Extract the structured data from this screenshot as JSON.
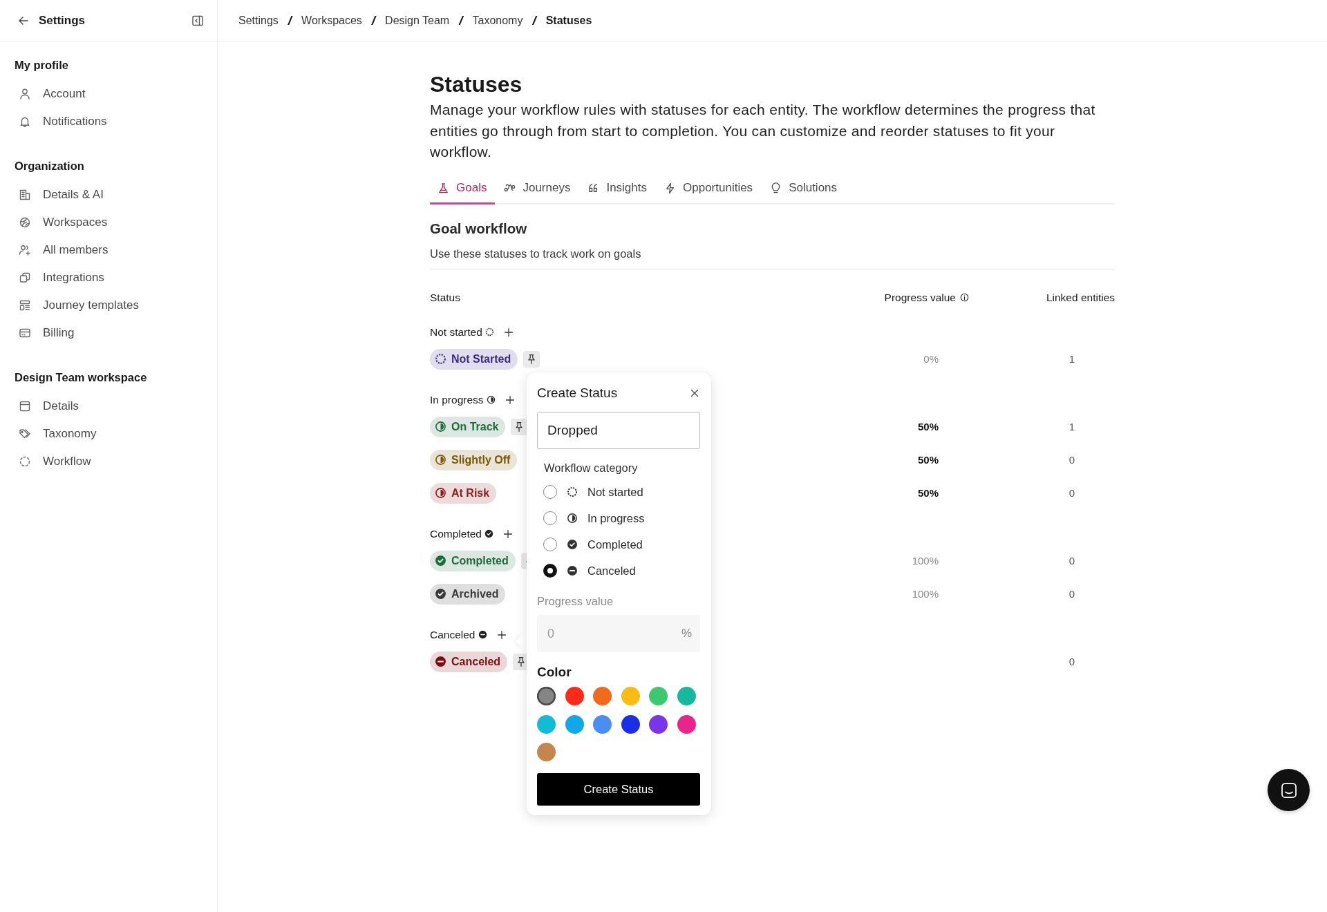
{
  "sidebar": {
    "title": "Settings",
    "sections": [
      {
        "heading": "My profile",
        "items": [
          {
            "label": "Account"
          },
          {
            "label": "Notifications"
          }
        ]
      },
      {
        "heading": "Organization",
        "items": [
          {
            "label": "Details & AI"
          },
          {
            "label": "Workspaces"
          },
          {
            "label": "All members"
          },
          {
            "label": "Integrations"
          },
          {
            "label": "Journey templates"
          },
          {
            "label": "Billing"
          }
        ]
      },
      {
        "heading": "Design Team workspace",
        "items": [
          {
            "label": "Details"
          },
          {
            "label": "Taxonomy"
          },
          {
            "label": "Workflow"
          }
        ]
      }
    ]
  },
  "breadcrumb": [
    {
      "label": "Settings",
      "current": false
    },
    {
      "separator": "/",
      "label": "Workspaces",
      "current": false
    },
    {
      "separator": "/",
      "label": "Design Team",
      "current": false
    },
    {
      "separator": "/",
      "label": "Taxonomy",
      "current": false
    },
    {
      "separator": "/",
      "label": "Statuses",
      "current": true
    }
  ],
  "page": {
    "title": "Statuses",
    "description": "Manage your workflow rules with statuses for each entity. The workflow determines the progress that entities go through from start to completion. You can customize and reorder statuses to fit your workflow."
  },
  "tabs": [
    {
      "label": "Goals",
      "selected": true
    },
    {
      "label": "Journeys",
      "selected": false
    },
    {
      "label": "Insights",
      "selected": false
    },
    {
      "label": "Opportunities",
      "selected": false
    },
    {
      "label": "Solutions",
      "selected": false
    }
  ],
  "workflow": {
    "title": "Goal workflow",
    "subtitle": "Use these statuses to track work on goals"
  },
  "table": {
    "columns": [
      "Status",
      "Progress value",
      "Linked entities"
    ],
    "groups": [
      {
        "label": "Not started",
        "kind": "not_started",
        "statuses": [
          {
            "label": "Not Started",
            "color": "#3d2a86",
            "pinned": true,
            "progress": "0%",
            "progress_editable": false,
            "linked": "1"
          }
        ]
      },
      {
        "label": "In progress",
        "kind": "in_progress",
        "statuses": [
          {
            "label": "On Track",
            "color": "#1d6a3c",
            "pinned": true,
            "progress": "50%",
            "progress_editable": true,
            "linked": "1"
          },
          {
            "label": "Slightly Off",
            "color": "#7a5600",
            "pinned": false,
            "progress": "50%",
            "progress_editable": true,
            "linked": "0"
          },
          {
            "label": "At Risk",
            "color": "#8c1b1b",
            "pinned": false,
            "progress": "50%",
            "progress_editable": true,
            "linked": "0"
          }
        ]
      },
      {
        "label": "Completed",
        "kind": "completed",
        "statuses": [
          {
            "label": "Completed",
            "color": "#1d6a3c",
            "pinned": true,
            "progress": "100%",
            "progress_editable": false,
            "linked": "0"
          },
          {
            "label": "Archived",
            "color": "#3a3a3a",
            "pinned": false,
            "progress": "100%",
            "progress_editable": false,
            "linked": "0"
          }
        ]
      },
      {
        "label": "Canceled",
        "kind": "canceled",
        "statuses": [
          {
            "label": "Canceled",
            "color": "#7a0d14",
            "pinned": true,
            "linked": "0"
          }
        ]
      }
    ]
  },
  "popover": {
    "title": "Create Status",
    "name_value": "Dropped",
    "category_label": "Workflow category",
    "categories": [
      {
        "label": "Not started",
        "kind": "not_started",
        "selected": false
      },
      {
        "label": "In progress",
        "kind": "in_progress",
        "selected": false
      },
      {
        "label": "Completed",
        "kind": "completed",
        "selected": false
      },
      {
        "label": "Canceled",
        "kind": "canceled",
        "selected": true
      }
    ],
    "progress_label": "Progress value",
    "progress_placeholder": "0",
    "progress_unit": "%",
    "color_label": "Color",
    "colors": [
      {
        "color": "#858585",
        "selected": true
      },
      {
        "color": "#ff2a1a",
        "selected": false
      },
      {
        "color": "#f26b1d",
        "selected": false
      },
      {
        "color": "#fbbc12",
        "selected": false
      },
      {
        "color": "#3cc86e",
        "selected": false
      },
      {
        "color": "#16b8a0",
        "selected": false
      },
      {
        "color": "#13bcd6",
        "selected": false
      },
      {
        "color": "#12a7e6",
        "selected": false
      },
      {
        "color": "#4a8ef5",
        "selected": false
      },
      {
        "color": "#1a2ee8",
        "selected": false
      },
      {
        "color": "#7a35ea",
        "selected": false
      },
      {
        "color": "#e8258a",
        "selected": false
      },
      {
        "color": "#c4864a",
        "selected": false
      }
    ],
    "submit": "Create Status"
  }
}
